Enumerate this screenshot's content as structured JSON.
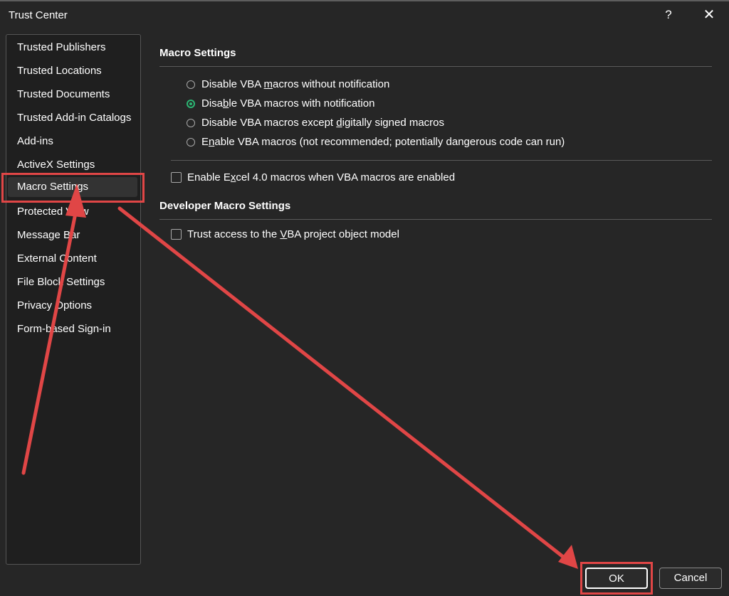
{
  "window": {
    "title": "Trust Center",
    "help_label": "?",
    "close_label": "✕"
  },
  "sidebar": {
    "items": [
      {
        "label": "Trusted Publishers",
        "selected": false
      },
      {
        "label": "Trusted Locations",
        "selected": false
      },
      {
        "label": "Trusted Documents",
        "selected": false
      },
      {
        "label": "Trusted Add-in Catalogs",
        "selected": false
      },
      {
        "label": "Add-ins",
        "selected": false
      },
      {
        "label": "ActiveX Settings",
        "selected": false
      },
      {
        "label": "Macro Settings",
        "selected": true
      },
      {
        "label": "Protected View",
        "selected": false
      },
      {
        "label": "Message Bar",
        "selected": false
      },
      {
        "label": "External Content",
        "selected": false
      },
      {
        "label": "File Block Settings",
        "selected": false
      },
      {
        "label": "Privacy Options",
        "selected": false
      },
      {
        "label": "Form-based Sign-in",
        "selected": false
      }
    ]
  },
  "macro_settings": {
    "title": "Macro Settings",
    "options": [
      {
        "pre": "Disable VBA ",
        "key": "m",
        "post": "acros without notification",
        "checked": false
      },
      {
        "pre": "Disa",
        "key": "b",
        "post": "le VBA macros with notification",
        "checked": true
      },
      {
        "pre": "Disable VBA macros except ",
        "key": "d",
        "post": "igitally signed macros",
        "checked": false
      },
      {
        "pre": "E",
        "key": "n",
        "post": "able VBA macros (not recommended; potentially dangerous code can run)",
        "checked": false
      }
    ],
    "excel4": {
      "pre": "Enable E",
      "key": "x",
      "post": "cel 4.0 macros when VBA macros are enabled",
      "checked": false
    }
  },
  "developer": {
    "title": "Developer Macro Settings",
    "trust_vba": {
      "pre": "Trust access to the ",
      "key": "V",
      "post": "BA project object model",
      "checked": false
    }
  },
  "buttons": {
    "ok": "OK",
    "cancel": "Cancel"
  },
  "colors": {
    "highlight": "#e04646",
    "radio_selected": "#2bb673",
    "background": "#262626"
  }
}
